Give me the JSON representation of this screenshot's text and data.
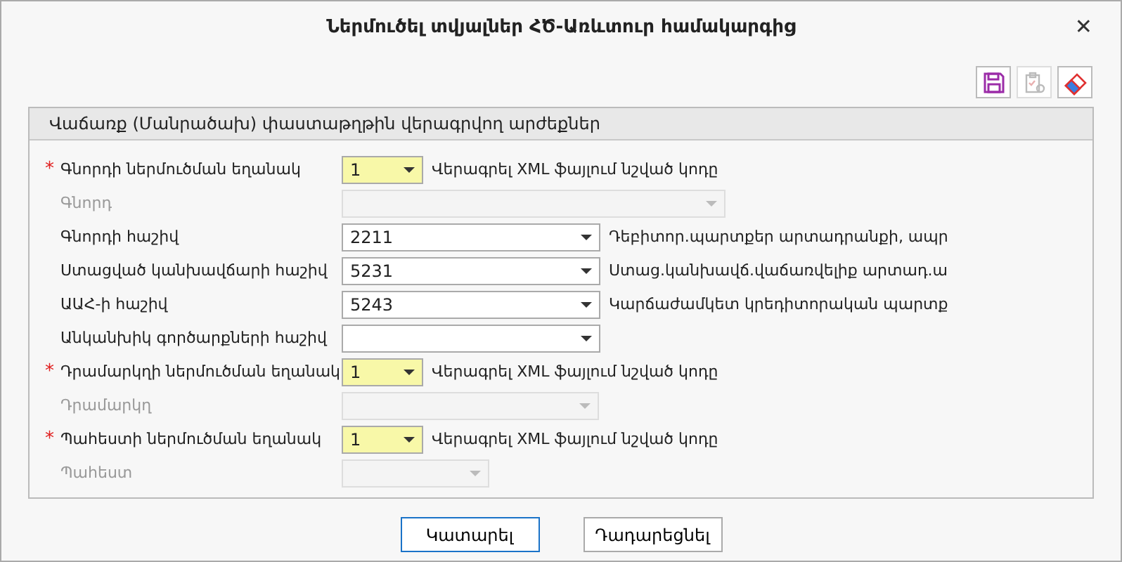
{
  "window": {
    "title": "Ներմուծել տվյալներ ՀԾ-Առևտուր համակարգից",
    "close": "✕"
  },
  "toolbar": [
    {
      "kind": "save",
      "disabled": false
    },
    {
      "kind": "clipboard",
      "disabled": true
    },
    {
      "kind": "eraser",
      "disabled": false
    }
  ],
  "panel": {
    "title": "Վաճառք (Մանրածախ) փաստաթղթին վերագրվող արժեքներ",
    "rows": [
      {
        "kind": "mode",
        "label": "Գնորդի ներմուծման եղանակ",
        "required_mark": "*",
        "value": "1",
        "note": "Վերագրել XML ֆայլում նշված կոդը"
      },
      {
        "kind": "wide",
        "label": "Գնորդ",
        "disabled": true
      },
      {
        "kind": "account",
        "label": "Գնորդի հաշիվ",
        "value": "2211",
        "note": "Դեբիտոր.պարտքեր արտադրանքի, ապր"
      },
      {
        "kind": "account",
        "label": "Ստացված կանխավճարի հաշիվ",
        "value": "5231",
        "note": "Ստաց.կանխավճ.վաճառվելիք արտադ.ա"
      },
      {
        "kind": "account",
        "label": "ԱԱՀ-ի հաշիվ",
        "value": "5243",
        "note": "Կարճաժամկետ կրեդիտորական պարտք"
      },
      {
        "kind": "account",
        "label": "Անկանխիկ գործարքների հաշիվ"
      },
      {
        "kind": "mode",
        "label": "Դրամարկղի ներմուծման եղանակ",
        "required_mark": "*",
        "value": "1",
        "note": "Վերագրել XML ֆայլում նշված կոդը"
      },
      {
        "kind": "mid",
        "label": "Դրամարկղ",
        "disabled": true
      },
      {
        "kind": "mode",
        "label": "Պահեստի ներմուծման եղանակ",
        "required_mark": "*",
        "value": "1",
        "note": "Վերագրել XML ֆայլում նշված կոդը"
      },
      {
        "kind": "narrow",
        "label": "Պահեստ",
        "disabled": true
      }
    ]
  },
  "buttons": [
    {
      "label": "Կատարել",
      "default": true
    },
    {
      "label": "Դադարեցնել",
      "default": false
    }
  ]
}
